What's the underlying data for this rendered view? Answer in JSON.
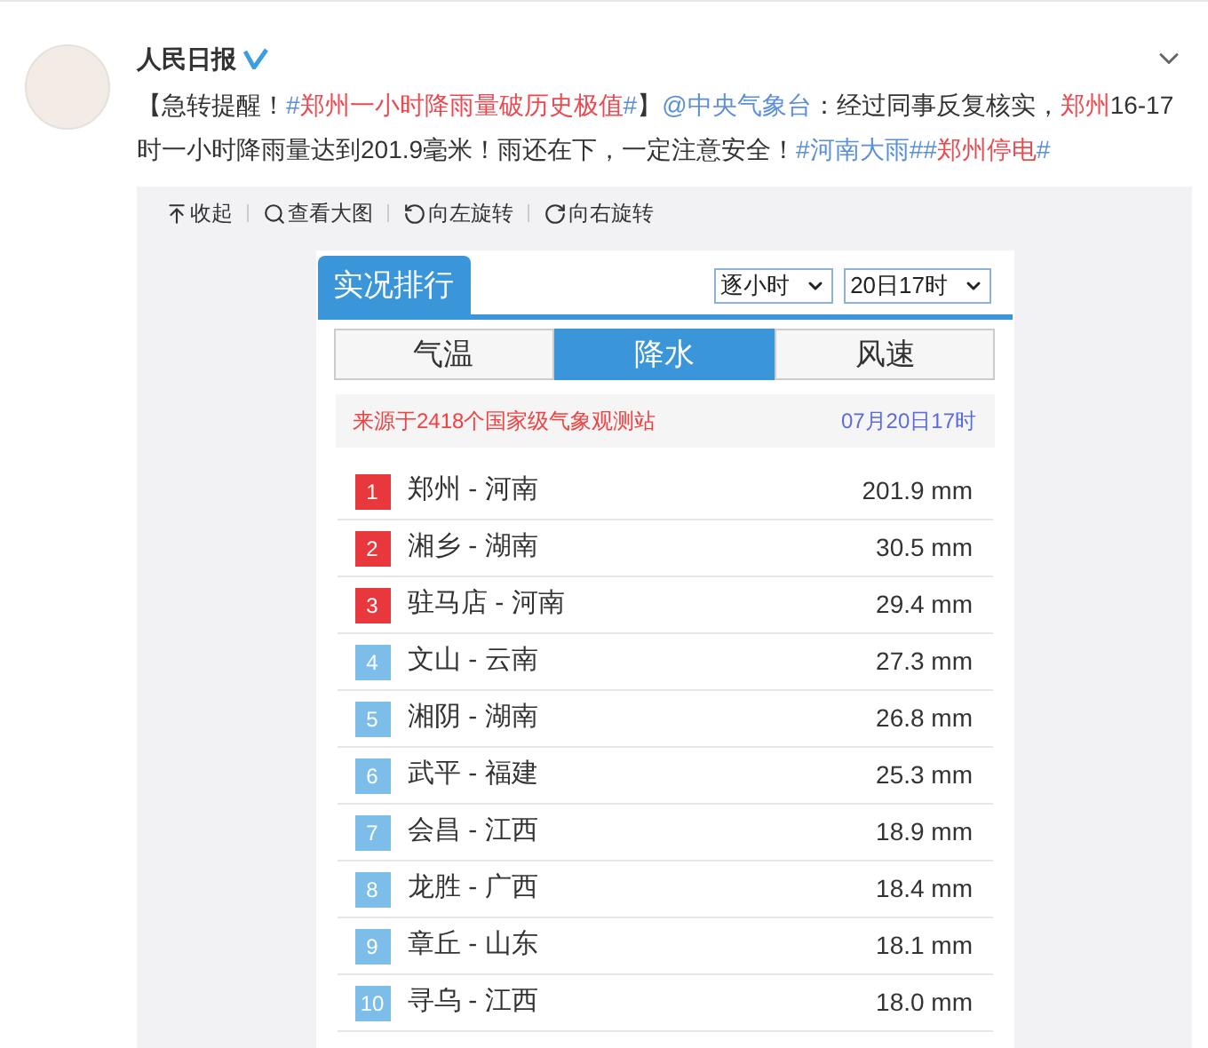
{
  "post": {
    "author": "人民日报",
    "verified": true,
    "segments": [
      {
        "kind": "plain",
        "text": "【急转提醒！"
      },
      {
        "kind": "hash",
        "text": "#"
      },
      {
        "kind": "keyword",
        "text": "郑州一小时降雨量破历史极值"
      },
      {
        "kind": "hash",
        "text": "#"
      },
      {
        "kind": "plain",
        "text": "】"
      },
      {
        "kind": "link",
        "text": "@中央气象台"
      },
      {
        "kind": "plain",
        "text": "：经过同事反复核实，"
      },
      {
        "kind": "keyword",
        "text": "郑州"
      },
      {
        "kind": "plain",
        "text": "16-17时一小时降雨量达到201.9毫米！雨还在下，一定注意安全！"
      },
      {
        "kind": "link",
        "text": "#河南大雨#"
      },
      {
        "kind": "hash",
        "text": "#"
      },
      {
        "kind": "keyword",
        "text": "郑州停电"
      },
      {
        "kind": "hash",
        "text": "#"
      }
    ]
  },
  "image_toolbar": [
    {
      "kind": "collapse",
      "label": "收起"
    },
    {
      "kind": "zoom",
      "label": "查看大图"
    },
    {
      "kind": "rotateleft",
      "label": "向左旋转"
    },
    {
      "kind": "rotateright",
      "label": "向右旋转"
    }
  ],
  "panel": {
    "title": "实况排行",
    "selects": [
      "逐小时",
      "20日17时"
    ],
    "tabs": [
      {
        "label": "气温",
        "selected": false
      },
      {
        "label": "降水",
        "selected": true
      },
      {
        "label": "风速",
        "selected": false
      }
    ],
    "source": "来源于2418个国家级气象观测站",
    "time": "07月20日17时",
    "rows": [
      {
        "rank": "1",
        "place": "郑州 - 河南",
        "value": "201.9 mm",
        "color": "#e8383d"
      },
      {
        "rank": "2",
        "place": "湘乡 - 湖南",
        "value": "30.5 mm",
        "color": "#e8383d"
      },
      {
        "rank": "3",
        "place": "驻马店 - 河南",
        "value": "29.4 mm",
        "color": "#e8383d"
      },
      {
        "rank": "4",
        "place": "文山 - 云南",
        "value": "27.3 mm",
        "color": "#7dbdea"
      },
      {
        "rank": "5",
        "place": "湘阴 - 湖南",
        "value": "26.8 mm",
        "color": "#7dbdea"
      },
      {
        "rank": "6",
        "place": "武平 - 福建",
        "value": "25.3 mm",
        "color": "#7dbdea"
      },
      {
        "rank": "7",
        "place": "会昌 - 江西",
        "value": "18.9 mm",
        "color": "#7dbdea"
      },
      {
        "rank": "8",
        "place": "龙胜 - 广西",
        "value": "18.4 mm",
        "color": "#7dbdea"
      },
      {
        "rank": "9",
        "place": "章丘 - 山东",
        "value": "18.1 mm",
        "color": "#7dbdea"
      },
      {
        "rank": "10",
        "place": "寻乌 - 江西",
        "value": "18.0 mm",
        "color": "#7dbdea"
      }
    ]
  }
}
